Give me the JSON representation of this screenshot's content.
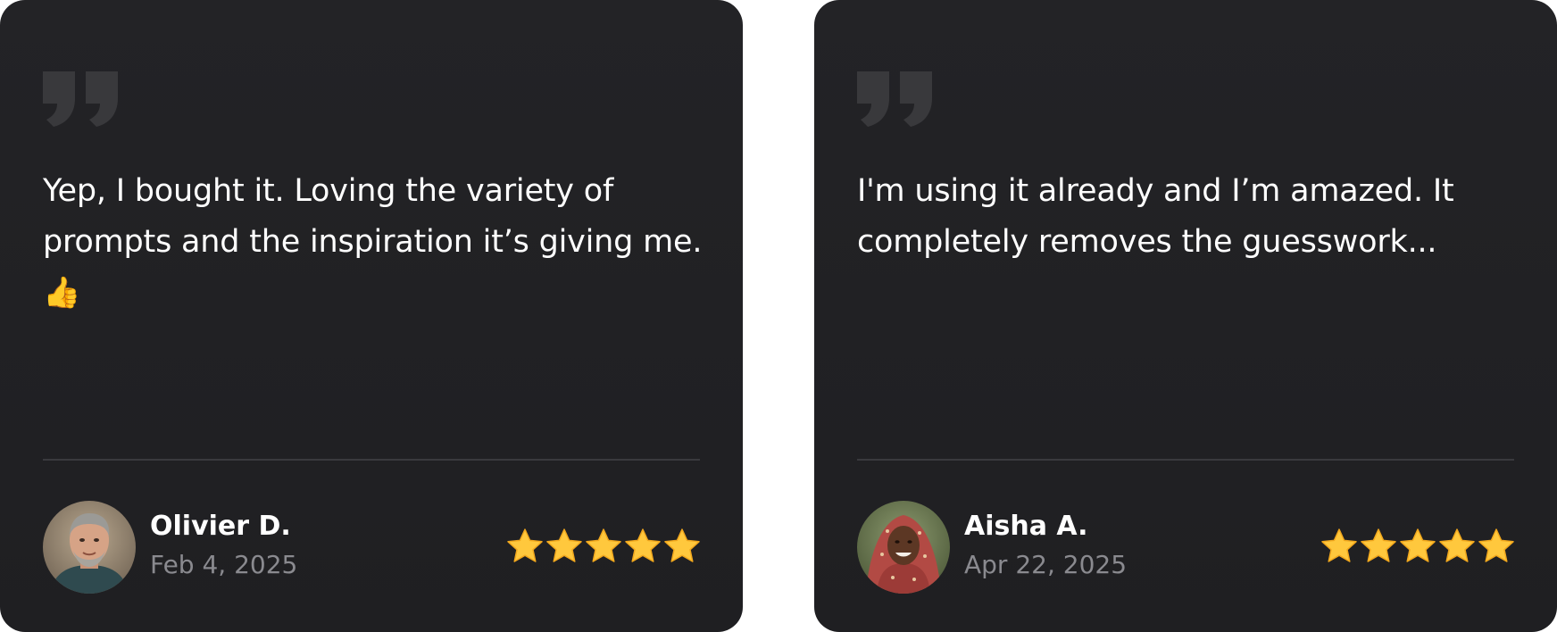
{
  "reviews": [
    {
      "quote_icon": "quote-icon",
      "text": "Yep, I bought it. Loving the variety of prompts and the inspiration it’s giving me.",
      "emoji": "👍",
      "avatar_icon": "avatar-olivier",
      "author": "Olivier D.",
      "date": "Feb 4, 2025",
      "rating": 5
    },
    {
      "quote_icon": "quote-icon",
      "text": "I'm using it already and I’m amazed. It completely removes the guesswork...",
      "avatar_icon": "avatar-aisha",
      "author": "Aisha A.",
      "date": "Apr 22, 2025",
      "rating": 5
    }
  ],
  "colors": {
    "card_background": "#222225",
    "text": "#ffffff",
    "muted_text": "#8a8a8f",
    "divider": "#3a3a3e",
    "quote_mark": "#3a3a3d",
    "star": "#ffc83d"
  }
}
